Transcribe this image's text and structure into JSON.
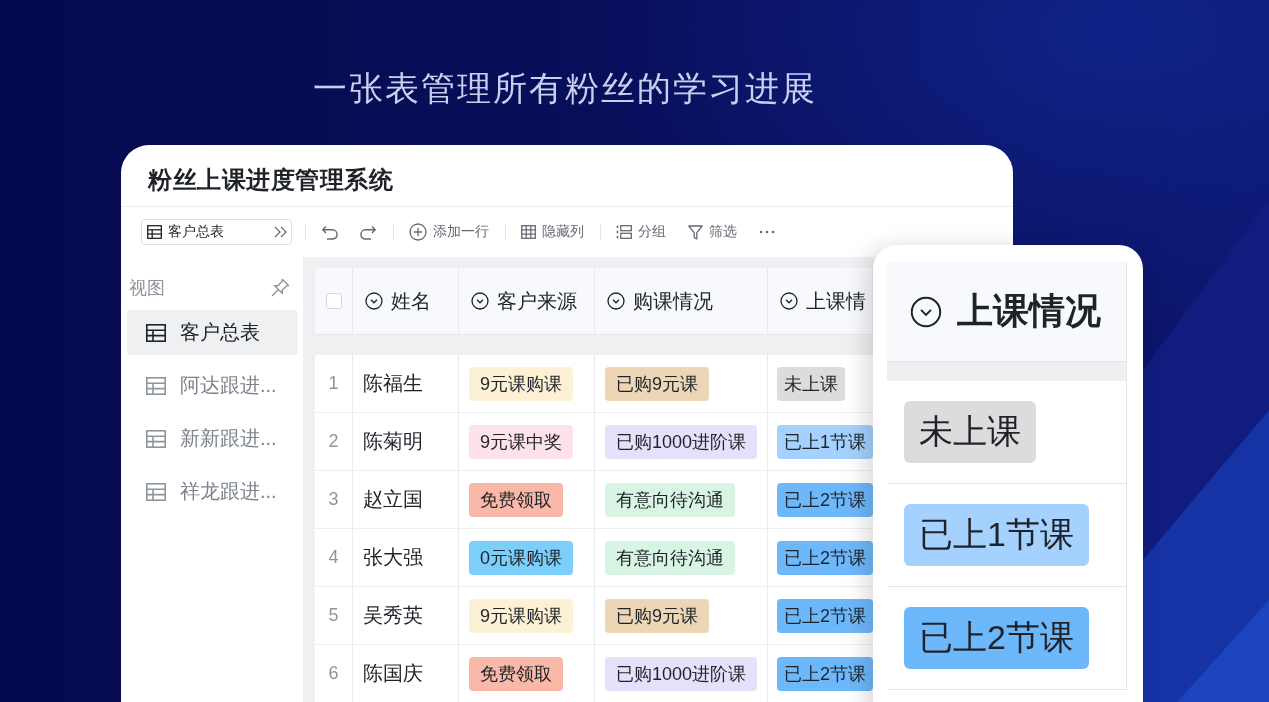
{
  "headline": "一张表管理所有粉丝的学习进展",
  "window": {
    "title": "粉丝上课进度管理系统"
  },
  "toolbar": {
    "view_selector": "客户总表",
    "actions": [
      {
        "kind": "add",
        "label": "添加一行",
        "divider_before": true
      },
      {
        "kind": "hide",
        "label": "隐藏列",
        "divider_before": true
      },
      {
        "kind": "group",
        "label": "分组",
        "divider_before": true
      },
      {
        "kind": "filter",
        "label": "筛选",
        "divider_before": false
      }
    ]
  },
  "sidebar": {
    "header": "视图",
    "items": [
      {
        "label": "客户总表",
        "selected": true
      },
      {
        "label": "阿达跟进...",
        "selected": false
      },
      {
        "label": "新新跟进...",
        "selected": false
      },
      {
        "label": "祥龙跟进...",
        "selected": false
      }
    ]
  },
  "table": {
    "header_checkbox": {
      "checked": false
    },
    "columns": [
      "姓名",
      "客户来源",
      "购课情况",
      "上课情"
    ],
    "rows": [
      {
        "index": "1",
        "name": "陈福生",
        "source": {
          "label": "9元课购课",
          "color": "#fdf1d5"
        },
        "purchase": {
          "label": "已购9元课",
          "color": "#ecd6b6"
        },
        "attendance": {
          "label": "未上课",
          "color": "#dcdcdd"
        }
      },
      {
        "index": "2",
        "name": "陈菊明",
        "source": {
          "label": "9元课中奖",
          "color": "#fde2ea"
        },
        "purchase": {
          "label": "已购1000进阶课",
          "color": "#e6e0fb"
        },
        "attendance": {
          "label": "已上1节课",
          "color": "#a4d1fd"
        }
      },
      {
        "index": "3",
        "name": "赵立国",
        "source": {
          "label": "免费领取",
          "color": "#fab9a8"
        },
        "purchase": {
          "label": "有意向待沟通",
          "color": "#d8f5e4"
        },
        "attendance": {
          "label": "已上2节课",
          "color": "#6db8fb"
        }
      },
      {
        "index": "4",
        "name": "张大强",
        "source": {
          "label": "0元课购课",
          "color": "#7ccffb"
        },
        "purchase": {
          "label": "有意向待沟通",
          "color": "#d8f5e4"
        },
        "attendance": {
          "label": "已上2节课",
          "color": "#6db8fb"
        }
      },
      {
        "index": "5",
        "name": "吴秀英",
        "source": {
          "label": "9元课购课",
          "color": "#fdf1d5"
        },
        "purchase": {
          "label": "已购9元课",
          "color": "#ecd6b6"
        },
        "attendance": {
          "label": "已上2节课",
          "color": "#6db8fb"
        }
      },
      {
        "index": "6",
        "name": "陈国庆",
        "source": {
          "label": "免费领取",
          "color": "#fab9a8"
        },
        "purchase": {
          "label": "已购1000进阶课",
          "color": "#e6e0fb"
        },
        "attendance": {
          "label": "已上2节课",
          "color": "#6db8fb"
        }
      }
    ]
  },
  "column_popup": {
    "header": "上课情况",
    "options": [
      {
        "label": "未上课",
        "color": "#dcdcdd"
      },
      {
        "label": "已上1节课",
        "color": "#a4d1fd"
      },
      {
        "label": "已上2节课",
        "color": "#6db8fb"
      }
    ]
  }
}
